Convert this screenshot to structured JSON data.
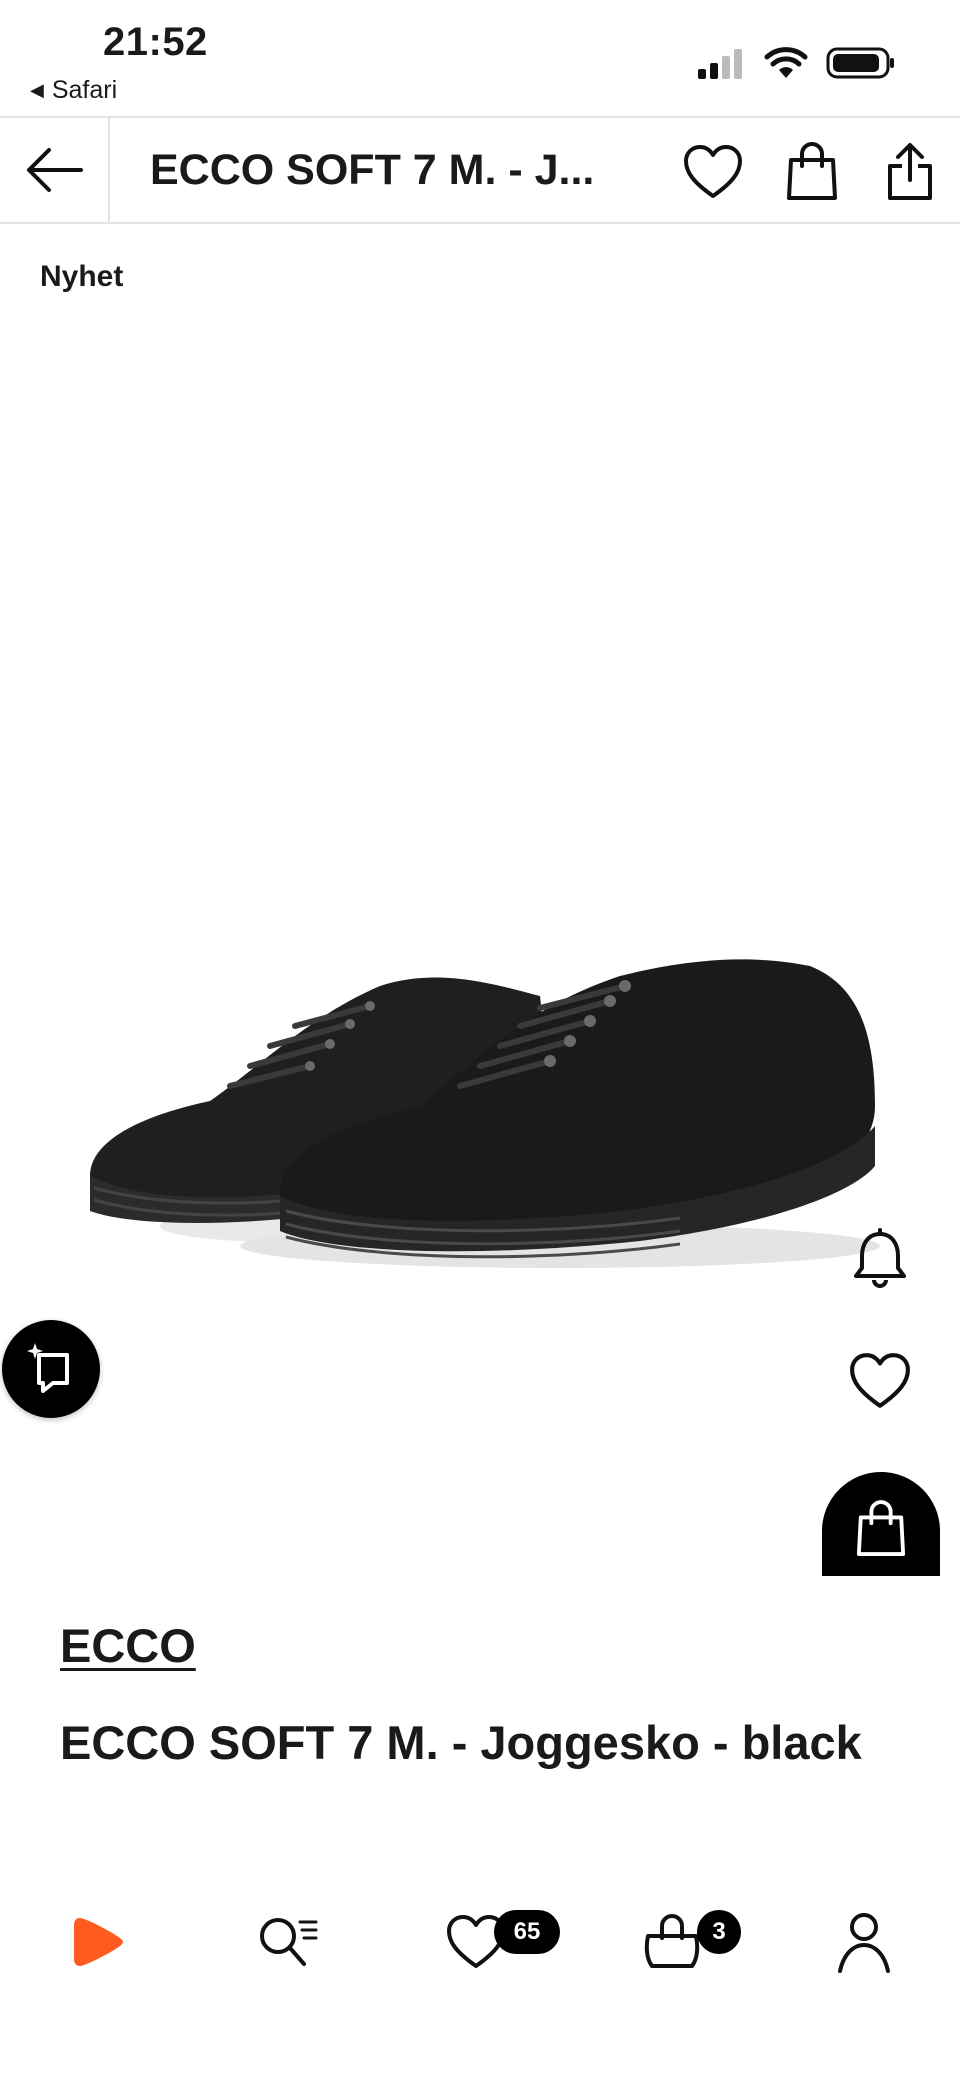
{
  "status_bar": {
    "time": "21:52",
    "back_app_label": "Safari"
  },
  "topnav": {
    "title": "ECCO SOFT 7 M. - J..."
  },
  "gallery": {
    "badge": "Nyhet"
  },
  "product": {
    "brand": "ECCO",
    "name": "ECCO SOFT 7 M. - Joggesko - black"
  },
  "tabbar": {
    "wishlist_count": "65",
    "bag_count": "3"
  },
  "colors": {
    "accent": "#ff5a1f",
    "text": "#1a1a1a",
    "border": "#e4e4e4",
    "fab": "#000000"
  }
}
